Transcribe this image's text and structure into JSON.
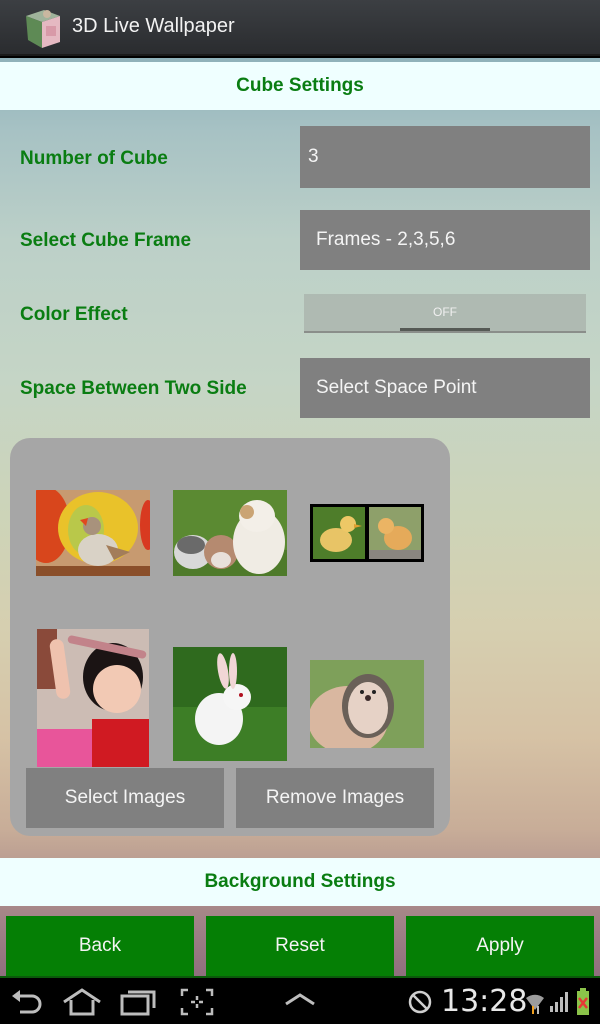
{
  "titlebar": {
    "title": "3D Live Wallpaper",
    "icon": "cube-app-icon"
  },
  "cube_settings": {
    "header": "Cube Settings",
    "rows": [
      {
        "label": "Number of Cube",
        "value": "3"
      },
      {
        "label": "Select Cube Frame",
        "value": "Frames - 2,3,5,6"
      },
      {
        "label": "Color Effect",
        "toggle_state": "OFF"
      },
      {
        "label": "Space Between Two Side",
        "value": "Select Space Point"
      }
    ]
  },
  "gallery": {
    "images": [
      {
        "subject": "finch bird with fruit"
      },
      {
        "subject": "three puppies on grass"
      },
      {
        "subject": "duckling and chick"
      },
      {
        "subject": "baby girl with headband"
      },
      {
        "subject": "white rabbit on grass"
      },
      {
        "subject": "hedgehog in hand"
      }
    ],
    "select_label": "Select Images",
    "remove_label": "Remove Images"
  },
  "background_settings": {
    "header": "Background Settings"
  },
  "actions": {
    "back": "Back",
    "reset": "Reset",
    "apply": "Apply"
  },
  "system_bar": {
    "time": "13:28",
    "icons": [
      "back-icon",
      "home-icon",
      "recent-apps-icon",
      "screenshot-icon",
      "up-chevron-icon",
      "no-sync-icon",
      "wifi-icon",
      "signal-icon",
      "battery-icon"
    ]
  },
  "colors": {
    "accent_green": "#057f05",
    "label_green": "#0a7d12",
    "header_bg": "#efffff",
    "field_gray": "#808080"
  }
}
